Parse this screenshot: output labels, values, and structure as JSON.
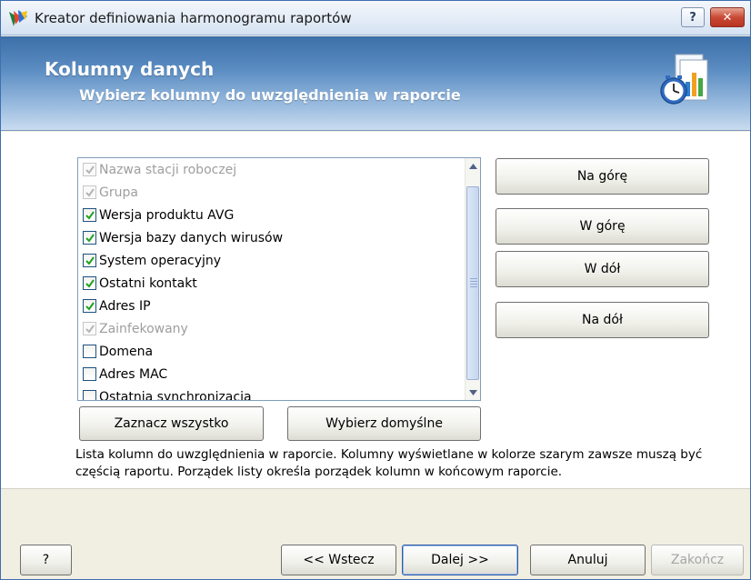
{
  "window": {
    "title": "Kreator definiowania harmonogramu raportów",
    "help_label": "?",
    "close_label": "✕"
  },
  "header": {
    "title": "Kolumny danych",
    "subtitle": "Wybierz kolumny do uwzględnienia w raporcie"
  },
  "columns_list": {
    "items": [
      {
        "label": "Nazwa stacji roboczej",
        "checked": true,
        "disabled": true
      },
      {
        "label": "Grupa",
        "checked": true,
        "disabled": true
      },
      {
        "label": "Wersja produktu AVG",
        "checked": true,
        "disabled": false
      },
      {
        "label": "Wersja bazy danych wirusów",
        "checked": true,
        "disabled": false
      },
      {
        "label": "System operacyjny",
        "checked": true,
        "disabled": false
      },
      {
        "label": "Ostatni kontakt",
        "checked": true,
        "disabled": false
      },
      {
        "label": "Adres IP",
        "checked": true,
        "disabled": false
      },
      {
        "label": "Zainfekowany",
        "checked": true,
        "disabled": true
      },
      {
        "label": "Domena",
        "checked": false,
        "disabled": false
      },
      {
        "label": "Adres MAC",
        "checked": false,
        "disabled": false
      },
      {
        "label": "Ostatnia synchronizacja",
        "checked": false,
        "disabled": false
      }
    ]
  },
  "order_buttons": {
    "top": "Na górę",
    "up": "W górę",
    "down": "W dół",
    "bottom": "Na dół"
  },
  "list_buttons": {
    "select_all": "Zaznacz wszystko",
    "select_default": "Wybierz domyślne"
  },
  "description": "Lista kolumn do uwzględnienia w raporcie. Kolumny wyświetlane w kolorze szarym zawsze muszą być częścią raportu. Porządek listy określa porządek kolumn w końcowym raporcie.",
  "footer": {
    "help": "?",
    "back": "<< Wstecz",
    "next": "Dalej >>",
    "cancel": "Anuluj",
    "finish": "Zakończ"
  },
  "icons": {
    "app": "avg-logo-icon",
    "report": "report-schedule-icon"
  }
}
